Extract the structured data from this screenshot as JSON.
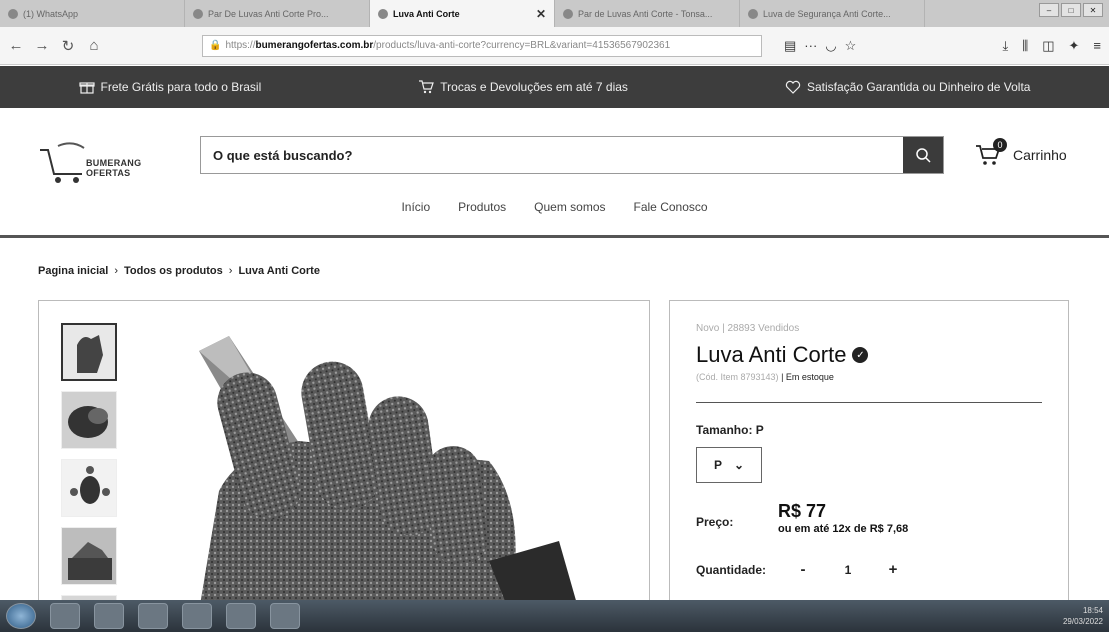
{
  "browser": {
    "tabs": [
      {
        "title": "(1) WhatsApp",
        "active": false
      },
      {
        "title": "Par De Luvas Anti Corte Pro...",
        "active": false
      },
      {
        "title": "Luva Anti Corte",
        "active": true
      },
      {
        "title": "Par de Luvas Anti Corte - Tonsa...",
        "active": false
      },
      {
        "title": "Luva de Segurança Anti Corte...",
        "active": false
      }
    ],
    "url_prefix": "https://",
    "url_domain": "bumerangofertas.com.br",
    "url_path": "/products/luva-anti-corte?currency=BRL&variant=41536567902361"
  },
  "announcement": {
    "items": [
      {
        "icon": "gift-icon",
        "label": "Frete Grátis para todo o Brasil"
      },
      {
        "icon": "cart-icon",
        "label": "Trocas e Devoluções em até 7 dias"
      },
      {
        "icon": "heart-icon",
        "label": "Satisfação Garantida ou Dinheiro de Volta"
      }
    ]
  },
  "header": {
    "logo_text": "BUMERANG OFERTAS",
    "search_placeholder": "O que está buscando?",
    "cart_label": "Carrinho",
    "cart_count": "0",
    "menu": [
      "Início",
      "Produtos",
      "Quem somos",
      "Fale Conosco"
    ]
  },
  "breadcrumb": [
    "Pagina inicial",
    "Todos os produtos",
    "Luva Anti Corte"
  ],
  "product": {
    "meta": "Novo | 28893 Vendidos",
    "title": "Luva Anti Corte",
    "sku": "(Cód. Item 8793143)",
    "stock": "| Em estoque",
    "size_label": "Tamanho: P",
    "size_value": "P",
    "price_label": "Preço:",
    "price": "R$ 77",
    "installments": "ou em até 12x de R$ 7,68",
    "qty_label": "Quantidade:",
    "qty_minus": "-",
    "qty_value": "1",
    "qty_plus": "+"
  },
  "taskbar": {
    "time": "18:54",
    "date": "29/03/2022"
  }
}
